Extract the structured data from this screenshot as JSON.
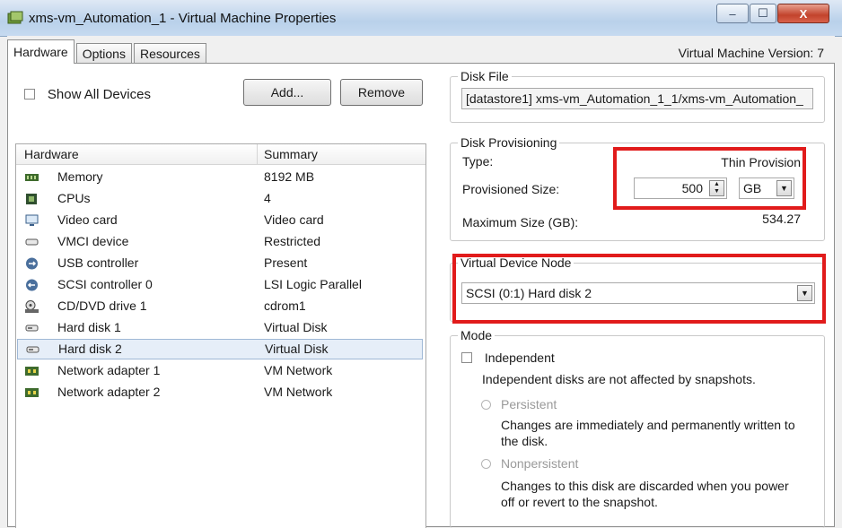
{
  "window": {
    "title": "xms-vm_Automation_1 - Virtual Machine Properties",
    "minimize": "–",
    "maximize": "☐",
    "close": "X"
  },
  "tabs": [
    "Hardware",
    "Options",
    "Resources"
  ],
  "vm_version": "Virtual Machine Version: 7",
  "left": {
    "show_all_devices": "Show All Devices",
    "add_button": "Add...",
    "remove_button": "Remove",
    "columns": {
      "hardware": "Hardware",
      "summary": "Summary"
    },
    "devices": [
      {
        "label": "Memory",
        "summary": "8192 MB",
        "icon": "memory-icon"
      },
      {
        "label": "CPUs",
        "summary": "4",
        "icon": "cpu-icon"
      },
      {
        "label": "Video card",
        "summary": "Video card",
        "icon": "monitor-icon"
      },
      {
        "label": "VMCI device",
        "summary": "Restricted",
        "icon": "device-icon"
      },
      {
        "label": "USB controller",
        "summary": "Present",
        "icon": "usb-icon"
      },
      {
        "label": "SCSI controller 0",
        "summary": "LSI Logic Parallel",
        "icon": "scsi-icon"
      },
      {
        "label": "CD/DVD drive 1",
        "summary": "cdrom1",
        "icon": "cdrom-icon"
      },
      {
        "label": "Hard disk 1",
        "summary": "Virtual Disk",
        "icon": "disk-icon"
      },
      {
        "label": "Hard disk 2",
        "summary": "Virtual Disk",
        "icon": "disk-icon"
      },
      {
        "label": "Network adapter 1",
        "summary": "VM Network",
        "icon": "network-icon"
      },
      {
        "label": "Network adapter 2",
        "summary": "VM Network",
        "icon": "network-icon"
      }
    ],
    "selected_index": 8
  },
  "right": {
    "disk_file": {
      "legend": "Disk File",
      "value": "[datastore1] xms-vm_Automation_1_1/xms-vm_Automation_"
    },
    "provisioning": {
      "legend": "Disk Provisioning",
      "type_label": "Type:",
      "type_value": "Thin Provision",
      "size_label": "Provisioned Size:",
      "size_value": "500",
      "unit": "GB",
      "max_label": "Maximum Size (GB):",
      "max_value": "534.27"
    },
    "device_node": {
      "legend": "Virtual Device Node",
      "value": "SCSI (0:1) Hard disk 2"
    },
    "mode": {
      "legend": "Mode",
      "independent_label": "Independent",
      "independent_desc": "Independent disks are not affected by snapshots.",
      "persistent_label": "Persistent",
      "persistent_desc_1": "Changes are immediately and permanently written to",
      "persistent_desc_2": "the disk.",
      "nonpersistent_label": "Nonpersistent",
      "nonpersistent_desc_1": "Changes to this disk are discarded when you power",
      "nonpersistent_desc_2": "off or revert to the snapshot."
    }
  },
  "colors": {
    "highlight": "#e11b1b",
    "selection": "#e6eef8"
  }
}
